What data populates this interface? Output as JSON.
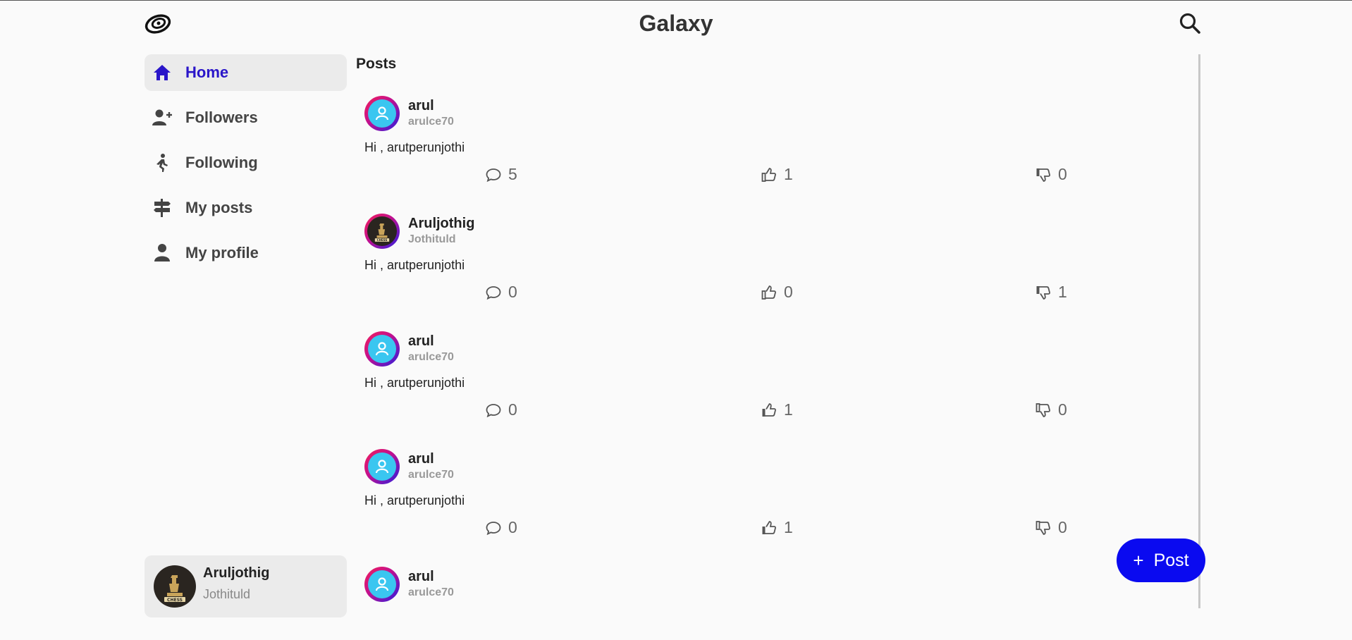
{
  "header": {
    "title": "Galaxy",
    "logo_icon": "galaxy-logo-icon",
    "search_icon": "search-icon"
  },
  "sidebar": {
    "items": [
      {
        "label": "Home",
        "icon": "home-icon",
        "active": true
      },
      {
        "label": "Followers",
        "icon": "user-plus-icon",
        "active": false
      },
      {
        "label": "Following",
        "icon": "walking-person-icon",
        "active": false
      },
      {
        "label": "My posts",
        "icon": "signpost-icon",
        "active": false
      },
      {
        "label": "My profile",
        "icon": "person-icon",
        "active": false
      }
    ],
    "current_user": {
      "name": "Aruljothig",
      "handle": "Jothituld"
    }
  },
  "main": {
    "heading": "Posts",
    "posts": [
      {
        "name": "arul",
        "handle": "arulce70",
        "text": "Hi , arutperunjothi",
        "comments": "5",
        "likes": "1",
        "dislikes": "0"
      },
      {
        "name": "Aruljothig",
        "handle": "Jothituld",
        "text": "Hi , arutperunjothi",
        "comments": "0",
        "likes": "0",
        "dislikes": "1"
      },
      {
        "name": "arul",
        "handle": "arulce70",
        "text": "Hi , arutperunjothi",
        "comments": "0",
        "likes": "1",
        "dislikes": "0"
      },
      {
        "name": "arul",
        "handle": "arulce70",
        "text": "Hi , arutperunjothi",
        "comments": "0",
        "likes": "1",
        "dislikes": "0"
      },
      {
        "name": "arul",
        "handle": "arulce70"
      }
    ]
  },
  "fab": {
    "plus": "+",
    "label": "Post"
  },
  "colors": {
    "accent": "#2a16c9",
    "fab": "#0a0af0",
    "active_bg": "#ebebeb"
  }
}
